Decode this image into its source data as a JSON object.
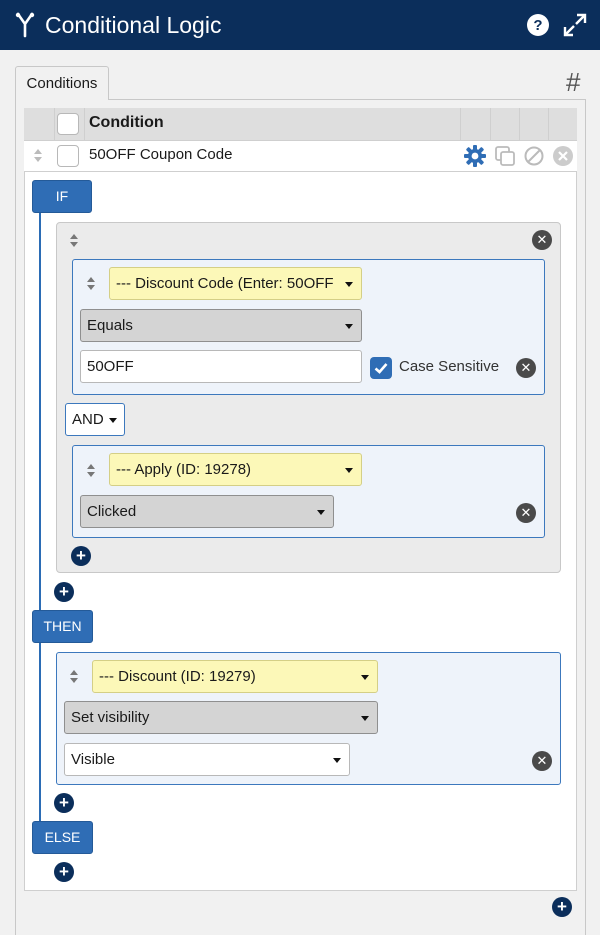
{
  "header": {
    "title": "Conditional Logic"
  },
  "tabs": [
    {
      "label": "Conditions"
    }
  ],
  "hash_label": "#",
  "table": {
    "header_label": "Condition",
    "row": {
      "label": "50OFF Coupon Code"
    }
  },
  "if_block": {
    "label": "IF",
    "condition1": {
      "field": "--- Discount Code (Enter: 50OFF",
      "operator": "Equals",
      "value": "50OFF",
      "case_sensitive_label": "Case Sensitive",
      "case_sensitive": true
    },
    "join": "AND",
    "condition2": {
      "field": "--- Apply (ID: 19278)",
      "operator": "Clicked"
    }
  },
  "then_block": {
    "label": "THEN",
    "action": {
      "field": "--- Discount (ID: 19279)",
      "action": "Set visibility",
      "value": "Visible"
    }
  },
  "else_block": {
    "label": "ELSE"
  },
  "colors": {
    "header_bg": "#0b2e5b",
    "accent": "#2f6db5",
    "yellow": "#fcf8b8"
  }
}
